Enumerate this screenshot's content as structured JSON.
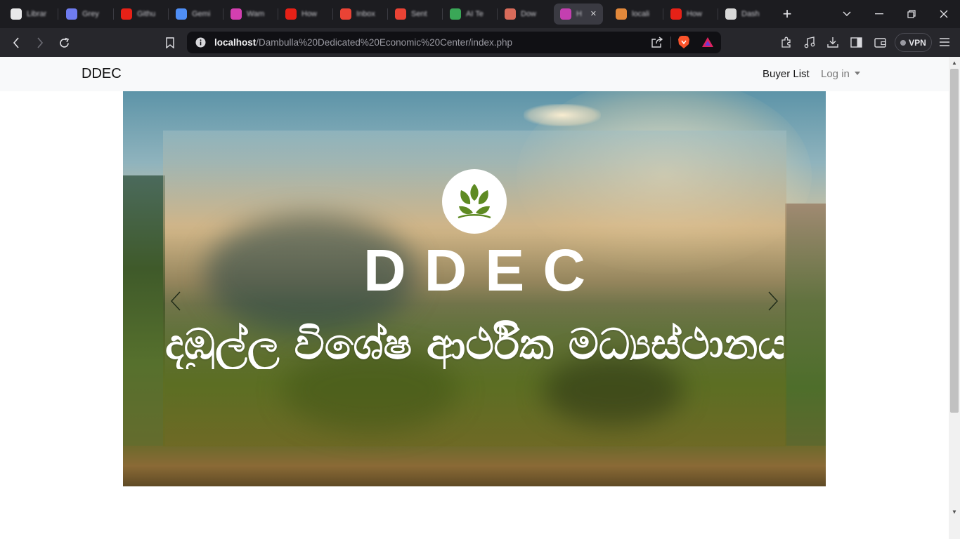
{
  "browser": {
    "tabs": [
      {
        "label": "Librar",
        "fav": "#e8e8ea",
        "icon": "github-icon"
      },
      {
        "label": "Grey",
        "fav": "#6f7cf0",
        "icon": "globe-icon"
      },
      {
        "label": "Githu",
        "fav": "#e62117",
        "icon": "youtube-icon"
      },
      {
        "label": "Gemi",
        "fav": "#4f8ff7",
        "icon": "gemini-icon"
      },
      {
        "label": "Wam",
        "fav": "#d33fb0",
        "icon": "app-icon"
      },
      {
        "label": "How",
        "fav": "#e62117",
        "icon": "youtube-icon"
      },
      {
        "label": "Inbox",
        "fav": "#ea4335",
        "icon": "gmail-icon"
      },
      {
        "label": "Sent",
        "fav": "#ea4335",
        "icon": "gmail-icon"
      },
      {
        "label": "AI Te",
        "fav": "#3aa757",
        "icon": "app-icon"
      },
      {
        "label": "Dow",
        "fav": "#d86b5a",
        "icon": "app-icon"
      },
      {
        "label": "H",
        "fav": "#c43fb0",
        "icon": "app-icon",
        "active": true
      },
      {
        "label": "locali",
        "fav": "#e2883b",
        "icon": "xampp-icon"
      },
      {
        "label": "How",
        "fav": "#e62117",
        "icon": "youtube-icon"
      },
      {
        "label": "Dash",
        "fav": "#d8d8d8",
        "icon": "app-icon"
      }
    ],
    "url_host": "localhost",
    "url_path": "/Dambulla%20Dedicated%20Economic%20Center/index.php",
    "vpn_label": "VPN"
  },
  "site": {
    "brand": "DDEC",
    "nav": {
      "buyer_list": "Buyer List",
      "login": "Log in"
    }
  },
  "carousel": {
    "heading": "DDEC",
    "subtitle": "දඹුල්ල විශේෂ ආර්ථික මධ්‍යස්ථානය",
    "prev": "previous-slide",
    "next": "next-slide"
  }
}
